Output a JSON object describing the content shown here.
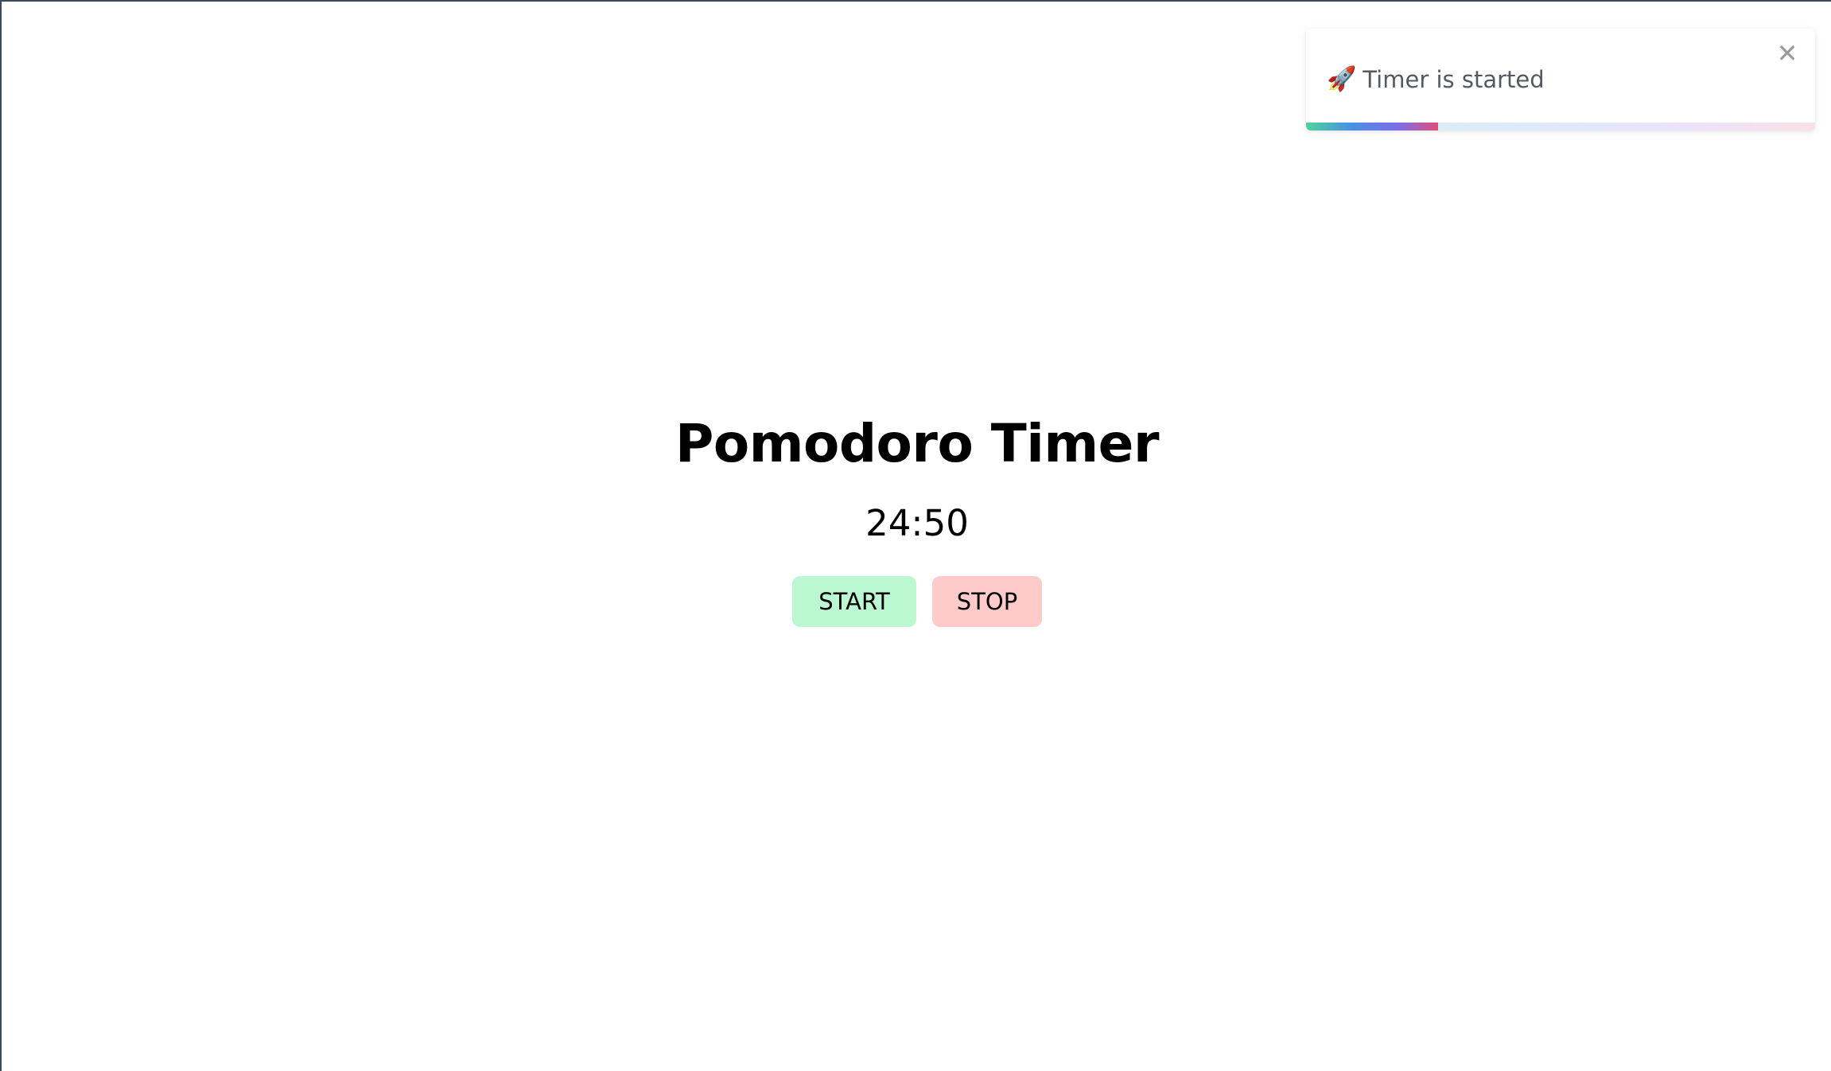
{
  "app": {
    "title": "Pomodoro Timer",
    "time_remaining": "24:50",
    "buttons": {
      "start_label": "START",
      "stop_label": "STOP"
    }
  },
  "toast": {
    "icon": "rocket-icon",
    "icon_glyph": "🚀",
    "message": "Timer is started",
    "close_glyph": "✕",
    "progress_fraction": 0.26
  },
  "colors": {
    "start_button_bg": "#bbf7d0",
    "stop_button_bg": "#fecaca",
    "title_text": "#000000",
    "toast_text": "#555a60"
  }
}
